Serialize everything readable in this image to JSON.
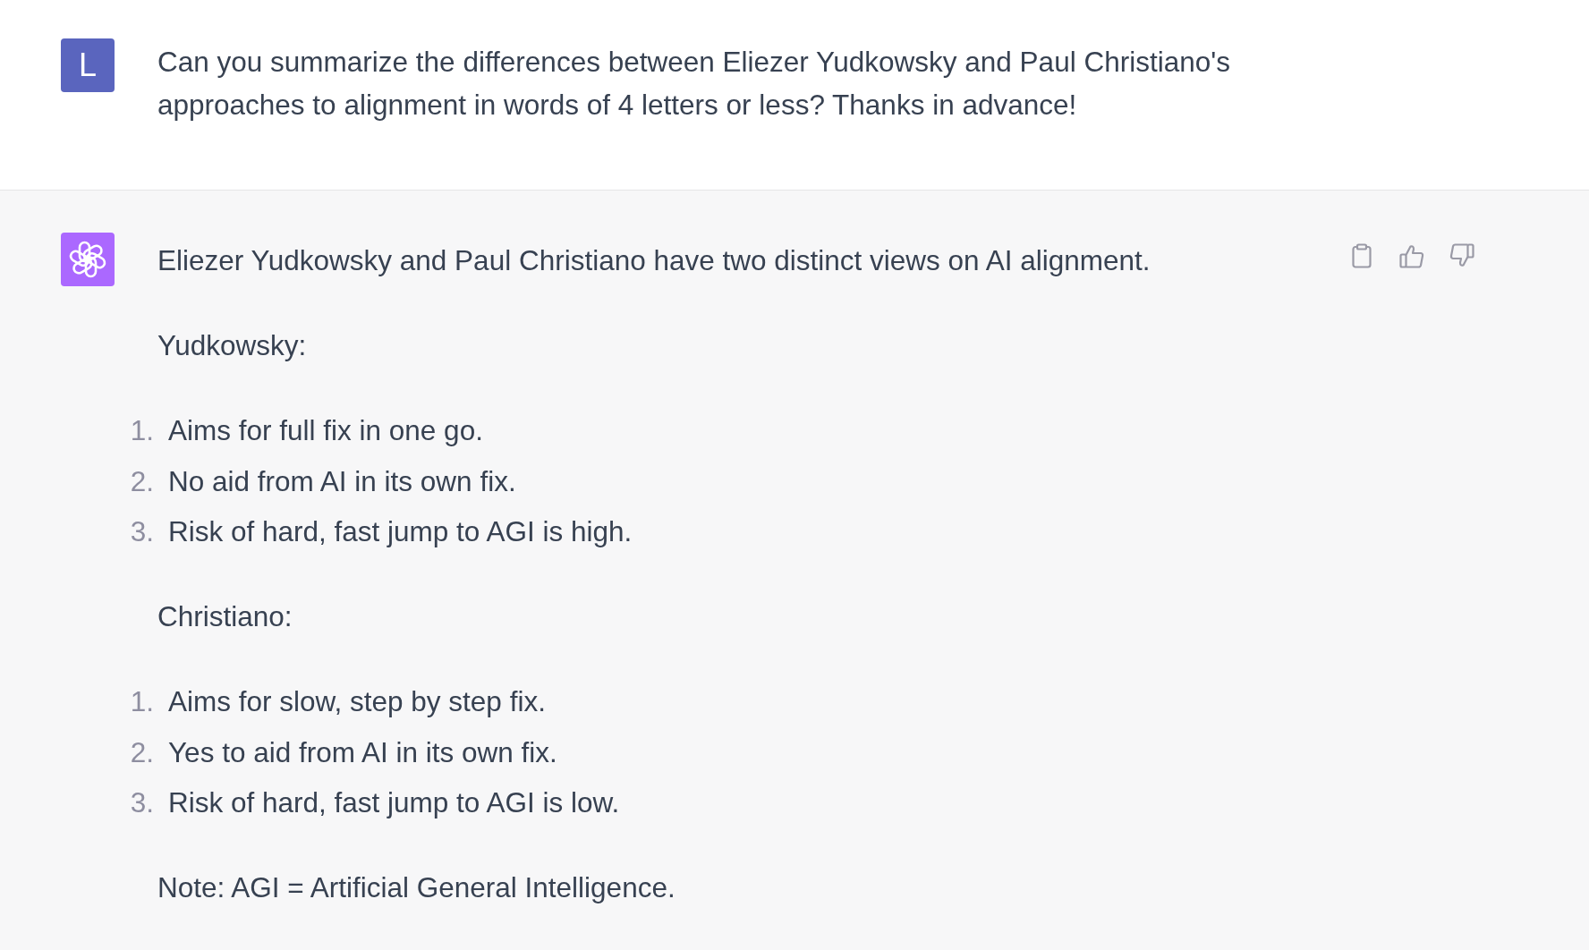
{
  "user_message": {
    "avatar_letter": "L",
    "text": "Can you summarize the differences between Eliezer Yudkowsky and Paul Christiano's approaches to alignment in words of 4 letters or less? Thanks in advance!"
  },
  "assistant_message": {
    "blocks": [
      {
        "kind": "paragraph",
        "text": "Eliezer Yudkowsky and Paul Christiano have two distinct views on AI alignment."
      },
      {
        "kind": "paragraph",
        "text": "Yudkowsky:"
      },
      {
        "kind": "list",
        "items": [
          {
            "number": "1.",
            "text": "Aims for full fix in one go."
          },
          {
            "number": "2.",
            "text": "No aid from AI in its own fix."
          },
          {
            "number": "3.",
            "text": "Risk of hard, fast jump to AGI is high."
          }
        ]
      },
      {
        "kind": "paragraph",
        "text": "Christiano:"
      },
      {
        "kind": "list",
        "items": [
          {
            "number": "1.",
            "text": "Aims for slow, step by step fix."
          },
          {
            "number": "2.",
            "text": "Yes to aid from AI in its own fix."
          },
          {
            "number": "3.",
            "text": "Risk of hard, fast jump to AGI is low."
          }
        ]
      },
      {
        "kind": "paragraph",
        "text": "Note: AGI = Artificial General Intelligence."
      }
    ]
  }
}
